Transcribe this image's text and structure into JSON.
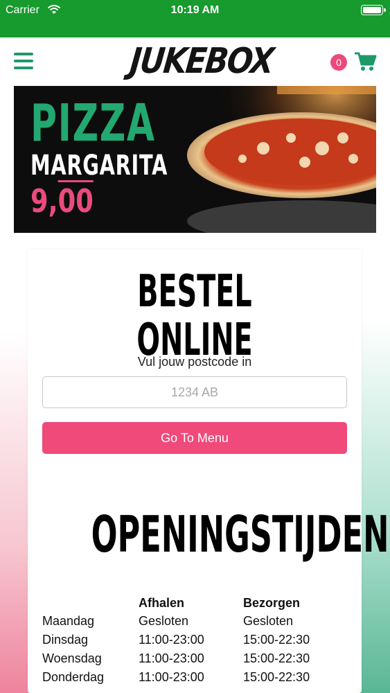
{
  "status_bar": {
    "carrier": "Carrier",
    "time": "10:19 AM"
  },
  "header": {
    "logo_text": "JUKEBOX",
    "cart_count": "0"
  },
  "banner": {
    "title": "PIZZA",
    "subtitle": "MARGARITA",
    "price_whole": "9,",
    "price_cents": "00"
  },
  "order": {
    "heading": "BESTEL ONLINE",
    "postcode_label": "Vul jouw postcode in",
    "postcode_placeholder": "1234 AB",
    "postcode_value": "",
    "button_label": "Go To Menu"
  },
  "hours": {
    "heading": "OPENINGSTIJDEN",
    "columns": [
      "",
      "Afhalen",
      "Bezorgen"
    ],
    "rows": [
      {
        "day": "Maandag",
        "pickup": "Gesloten",
        "delivery": "Gesloten"
      },
      {
        "day": "Dinsdag",
        "pickup": "11:00-23:00",
        "delivery": "15:00-22:30"
      },
      {
        "day": "Woensdag",
        "pickup": "11:00-23:00",
        "delivery": "15:00-22:30"
      },
      {
        "day": "Donderdag",
        "pickup": "11:00-23:00",
        "delivery": "15:00-22:30"
      }
    ]
  },
  "colors": {
    "status_bar": "#179a2e",
    "brand_green": "#1e9a6a",
    "accent_pink": "#ef4a7a"
  },
  "icons": [
    "wifi-icon",
    "battery-icon",
    "menu-icon",
    "cart-icon"
  ]
}
